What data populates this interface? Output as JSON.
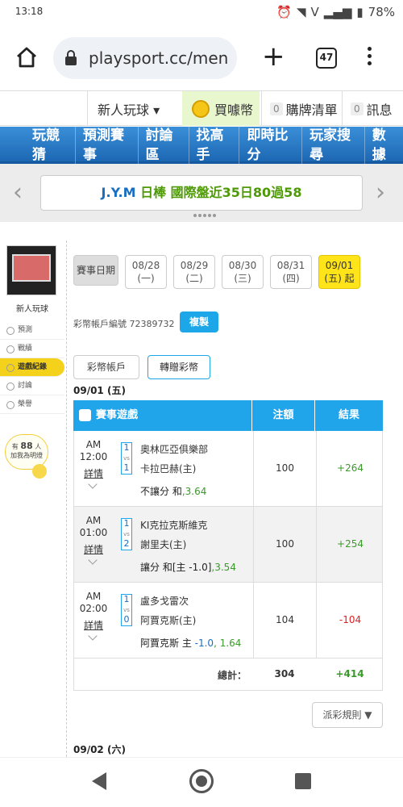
{
  "status": {
    "time": "13:18",
    "battery": "78%"
  },
  "browser": {
    "url": "playsport.cc/men",
    "tab_count": "47"
  },
  "siterow": {
    "newbie": "新人玩球 ▾",
    "buy": "買噱幣",
    "cart_count": "0",
    "cart": "購牌清單",
    "msg_count": "0",
    "msg": "訊息"
  },
  "nav": [
    "玩競猜",
    "預測賽事",
    "討論區",
    "找高手",
    "即時比分",
    "玩家搜尋",
    "數據"
  ],
  "announce": {
    "part1": "J.Y.M ",
    "part2": "日棒 國際盤近35日80過58"
  },
  "sidebar": {
    "username": "新人玩球",
    "menu": [
      "預測",
      "戰績",
      "遊戲紀錄",
      "討論",
      "榮譽"
    ],
    "hint_pre": "有",
    "hint_num": "88",
    "hint_suf": "人",
    "hint_line2": "加我為明燈"
  },
  "dates": {
    "label": "賽事日期",
    "items": [
      {
        "d": "08/28",
        "w": "(一)"
      },
      {
        "d": "08/29",
        "w": "(二)"
      },
      {
        "d": "08/30",
        "w": "(三)"
      },
      {
        "d": "08/31",
        "w": "(四)"
      },
      {
        "d": "09/01",
        "w": "(五) 起"
      }
    ]
  },
  "account": {
    "label": "彩幣帳戶編號 72389732",
    "copy": "複製",
    "tab1": "彩幣帳戶",
    "tab2": "轉贈彩幣"
  },
  "day1": "09/01 (五)",
  "table": {
    "h1": "賽事遊戲",
    "h2": "注額",
    "h3": "結果",
    "rows": [
      {
        "ampm": "AM",
        "time": "12:00",
        "detail": "詳情",
        "s1": "1",
        "s2": "1",
        "teamA": "奧林匹亞俱樂部",
        "teamB": "卡拉巴赫(主)",
        "bet": "不讓分 和",
        "odds": ",3.64",
        "line": "",
        "amount": "100",
        "result": "+264"
      },
      {
        "ampm": "AM",
        "time": "01:00",
        "detail": "詳情",
        "s1": "1",
        "s2": "2",
        "teamA": "KI克拉克斯維克",
        "teamB": "謝里夫(主)",
        "bet": "讓分 和[主 -1.0]",
        "odds": ",3.54",
        "line": "",
        "amount": "100",
        "result": "+254"
      },
      {
        "ampm": "AM",
        "time": "02:00",
        "detail": "詳情",
        "s1": "1",
        "s2": "0",
        "teamA": "盧多戈雷次",
        "teamB": "阿賈克斯(主)",
        "bet": "阿賈克斯 主 ",
        "odds": ", 1.64",
        "line": "-1.0",
        "amount": "104",
        "result": "-104"
      }
    ],
    "total_label": "總計：",
    "total_amount": "304",
    "total_result": "+414"
  },
  "rule_btn": "派彩規則 ▼",
  "day2": "09/02 (六)"
}
